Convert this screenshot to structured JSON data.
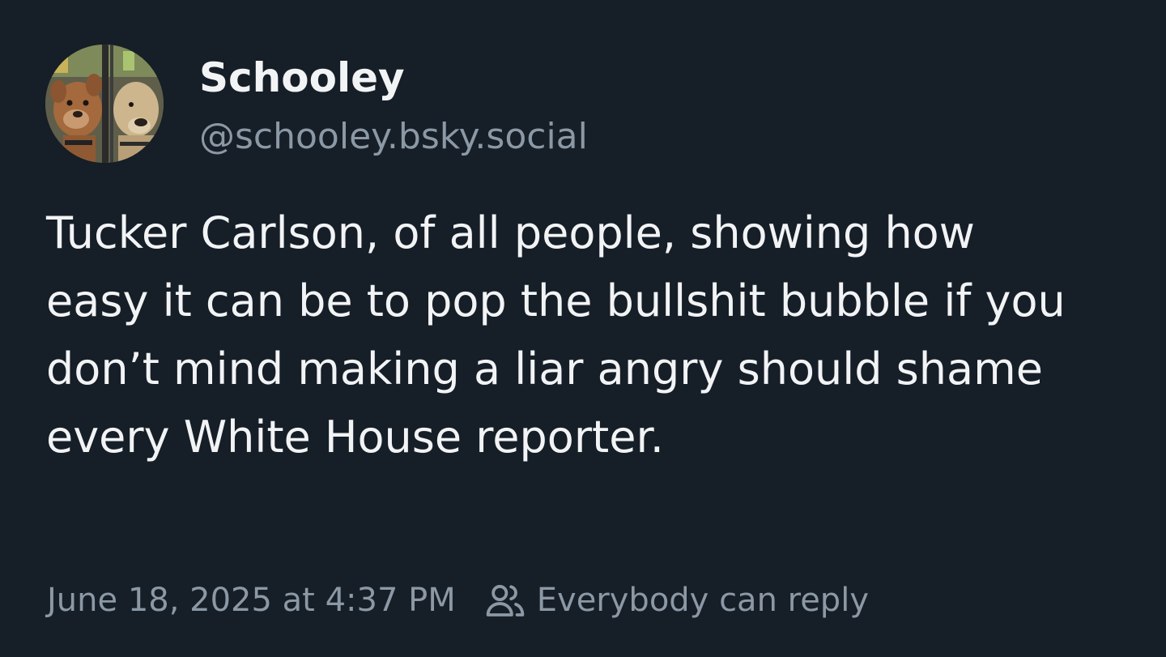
{
  "author": {
    "display_name": "Schooley",
    "handle": "@schooley.bsky.social",
    "avatar_icon": "dogs-avatar-icon"
  },
  "post": {
    "text": "Tucker Carlson, of all people, showing how easy it can be to pop the bullshit bubble if you don’t mind making a liar angry should shame every White House reporter."
  },
  "meta": {
    "timestamp": "June 18, 2025 at 4:37 PM",
    "reply_setting_icon": "people-icon",
    "reply_setting": "Everybody can reply"
  },
  "colors": {
    "background": "#161e27",
    "text_primary": "#f1f3f5",
    "text_secondary": "#8b98a5"
  }
}
